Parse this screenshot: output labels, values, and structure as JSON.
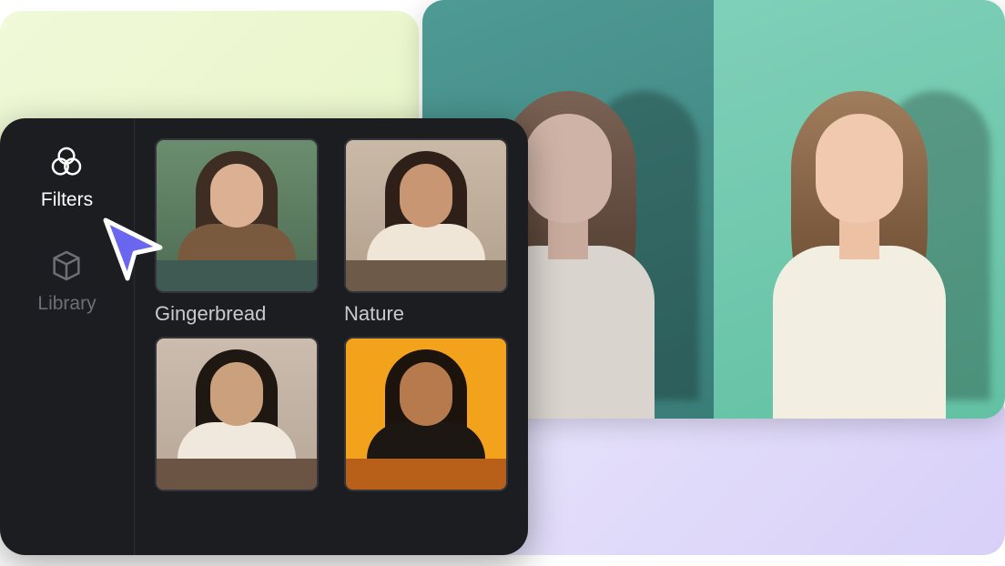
{
  "sidebar": {
    "items": [
      {
        "label": "Filters",
        "icon": "filters-icon",
        "active": true
      },
      {
        "label": "Library",
        "icon": "library-icon",
        "active": false
      }
    ]
  },
  "filters": [
    {
      "label": "Gingerbread",
      "swatch": "#3f5a53"
    },
    {
      "label": "Nature",
      "swatch": "#6e5a49"
    },
    {
      "label": "",
      "swatch": "#6c5444"
    },
    {
      "label": "",
      "swatch": "#b85f19"
    }
  ],
  "colors": {
    "panel_bg": "#1c1d21",
    "cursor": "#6a66f0"
  }
}
